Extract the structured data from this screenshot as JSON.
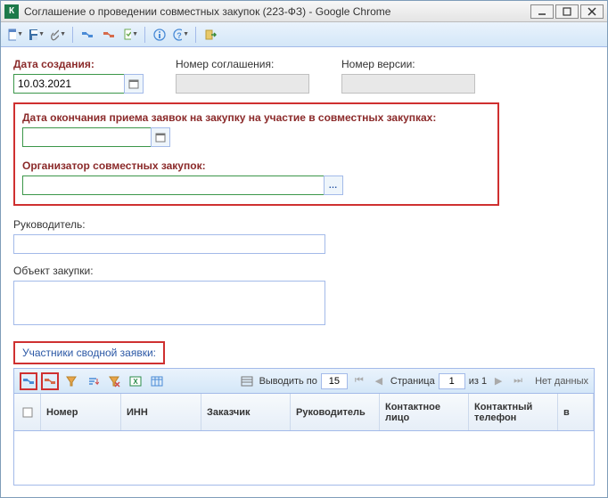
{
  "window": {
    "title": "Соглашение о проведении совместных закупок (223-ФЗ) - Google Chrome"
  },
  "toolbar": {
    "icons": [
      "new",
      "save",
      "attach",
      "link1",
      "link2",
      "doc",
      "info",
      "help",
      "exit"
    ]
  },
  "fields": {
    "created_label": "Дата создания:",
    "created_value": "10.03.2021",
    "agreement_no_label": "Номер соглашения:",
    "agreement_no_value": "",
    "version_no_label": "Номер версии:",
    "version_no_value": "",
    "deadline_label": "Дата окончания приема заявок на закупку на участие в совместных закупках:",
    "deadline_value": "",
    "organizer_label": "Организатор совместных закупок:",
    "organizer_value": "",
    "director_label": "Руководитель:",
    "director_value": "",
    "object_label": "Объект закупки:",
    "object_value": ""
  },
  "section": {
    "participants_label": "Участники сводной заявки:"
  },
  "grid": {
    "output_label": "Выводить по",
    "page_size": "15",
    "page_label": "Страница",
    "page_current": "1",
    "page_of": "из 1",
    "no_data": "Нет данных",
    "columns": {
      "number": "Номер",
      "inn": "ИНН",
      "customer": "Заказчик",
      "director": "Руководитель",
      "contact_person": "Контактное лицо",
      "contact_phone": "Контактный телефон",
      "more": "в"
    }
  }
}
